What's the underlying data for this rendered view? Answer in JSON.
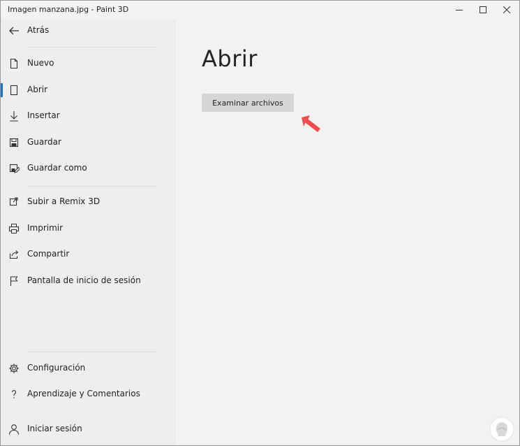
{
  "window": {
    "title": "Imagen manzana.jpg - Paint 3D",
    "controls": [
      "minimize-icon",
      "maximize-icon",
      "close-icon"
    ]
  },
  "sidebar": {
    "back": {
      "label": "Atrás",
      "icon": "back-arrow-icon"
    },
    "items": [
      {
        "label": "Nuevo",
        "icon": "new-file-icon"
      },
      {
        "label": "Abrir",
        "icon": "open-icon",
        "active": true
      },
      {
        "label": "Insertar",
        "icon": "insert-icon"
      },
      {
        "label": "Guardar",
        "icon": "save-icon"
      },
      {
        "label": "Guardar como",
        "icon": "save-as-icon"
      },
      {
        "label": "Subir a Remix 3D",
        "icon": "upload-icon"
      },
      {
        "label": "Imprimir",
        "icon": "print-icon"
      },
      {
        "label": "Compartir",
        "icon": "share-icon"
      },
      {
        "label": "Pantalla de inicio de sesión",
        "icon": "flag-icon"
      }
    ],
    "footer": [
      {
        "label": "Configuración",
        "icon": "gear-icon"
      },
      {
        "label": "Aprendizaje y Comentarios",
        "icon": "question-icon"
      },
      {
        "label": "Iniciar sesión",
        "icon": "person-icon"
      }
    ]
  },
  "main": {
    "heading": "Abrir",
    "browse_button": "Examinar archivos"
  },
  "colors": {
    "accent": "#1a73c8",
    "arrow": "#f04e4e"
  }
}
